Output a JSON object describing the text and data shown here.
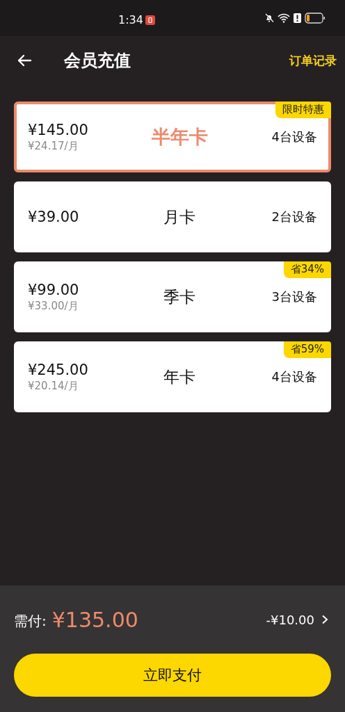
{
  "status_bar": {
    "time": "1:34"
  },
  "header": {
    "title": "会员充值",
    "action": "订单记录"
  },
  "plans": [
    {
      "price": "¥145.00",
      "monthly": "¥24.17/月",
      "name": "半年卡",
      "devices": "4台设备",
      "badge": "限时特惠",
      "selected": true
    },
    {
      "price": "¥39.00",
      "name": "月卡",
      "devices": "2台设备",
      "selected": false
    },
    {
      "price": "¥99.00",
      "monthly": "¥33.00/月",
      "name": "季卡",
      "devices": "3台设备",
      "badge": "省34%",
      "selected": false
    },
    {
      "price": "¥245.00",
      "monthly": "¥20.14/月",
      "name": "年卡",
      "devices": "4台设备",
      "badge": "省59%",
      "selected": false
    }
  ],
  "footer": {
    "label": "需付:",
    "amount": "¥135.00",
    "discount": "-¥10.00",
    "pay_button": "立即支付"
  }
}
